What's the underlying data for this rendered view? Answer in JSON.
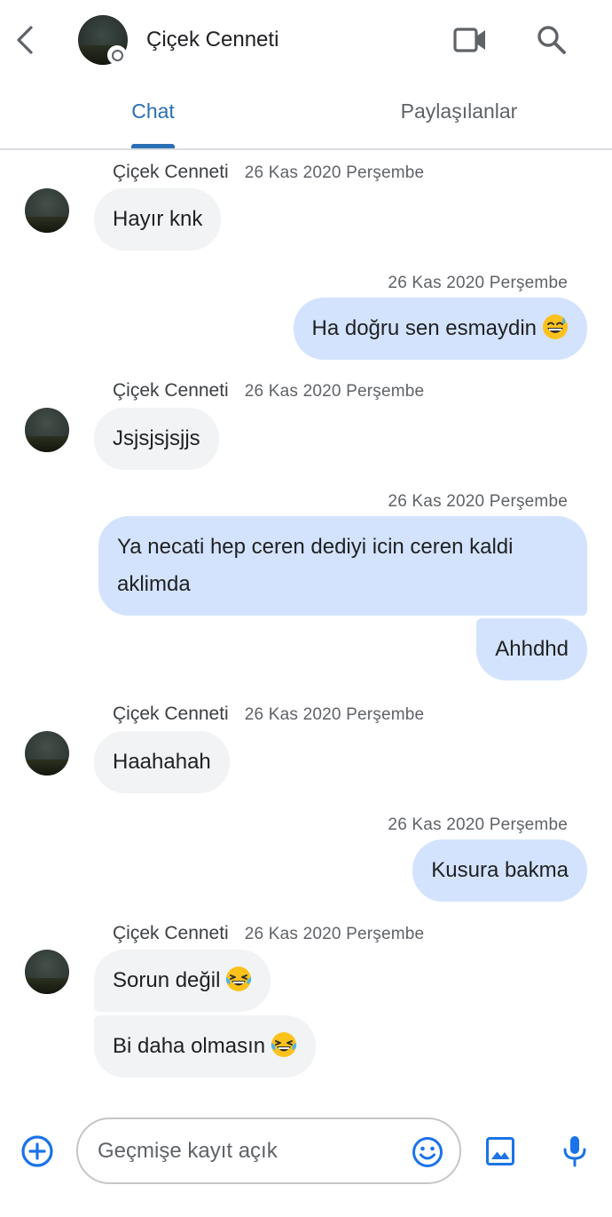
{
  "header": {
    "title": "Çiçek Cenneti",
    "back_icon": "arrow-back-icon",
    "video_icon": "video-camera-icon",
    "search_icon": "search-icon"
  },
  "tabs": [
    {
      "label": "Chat",
      "active": true
    },
    {
      "label": "Paylaşılanlar",
      "active": false
    }
  ],
  "messages": [
    {
      "direction": "in",
      "sender": "Çiçek Cenneti",
      "time": "26 Kas 2020 Perşembe",
      "text": "Hayır knk"
    },
    {
      "direction": "out",
      "time": "26 Kas 2020 Perşembe",
      "text": "Ha doğru sen esmaydin",
      "emoji": "grinning-sweat-emoji"
    },
    {
      "direction": "in",
      "sender": "Çiçek Cenneti",
      "time": "26 Kas 2020 Perşembe",
      "text": "Jsjsjsjsjjs"
    },
    {
      "direction": "out",
      "time": "26 Kas 2020 Perşembe",
      "text": "Ya necati hep ceren dediyi icin ceren kaldi aklimda"
    },
    {
      "direction": "out",
      "text": "Ahhdhd"
    },
    {
      "direction": "in",
      "sender": "Çiçek Cenneti",
      "time": "26 Kas 2020 Perşembe",
      "text": "Haahahah"
    },
    {
      "direction": "out",
      "time": "26 Kas 2020 Perşembe",
      "text": "Kusura bakma"
    },
    {
      "direction": "in",
      "sender": "Çiçek Cenneti",
      "time": "26 Kas 2020 Perşembe",
      "text": "Sorun değil",
      "emoji": "tears-of-joy-emoji"
    },
    {
      "direction": "in",
      "text": "Bi daha olmasın",
      "emoji": "tears-of-joy-emoji"
    }
  ],
  "composer": {
    "placeholder": "Geçmişe kayıt açık",
    "value": "",
    "add_icon": "add-circle-icon",
    "emoji_icon": "smiley-icon",
    "image_icon": "image-icon",
    "mic_icon": "microphone-icon"
  },
  "colors": {
    "accent": "#2a6fb5",
    "incoming_bubble": "#f1f3f4",
    "outgoing_bubble": "#d3e3fd",
    "icon_blue": "#1a73e8",
    "icon_gray": "#5f6368"
  }
}
